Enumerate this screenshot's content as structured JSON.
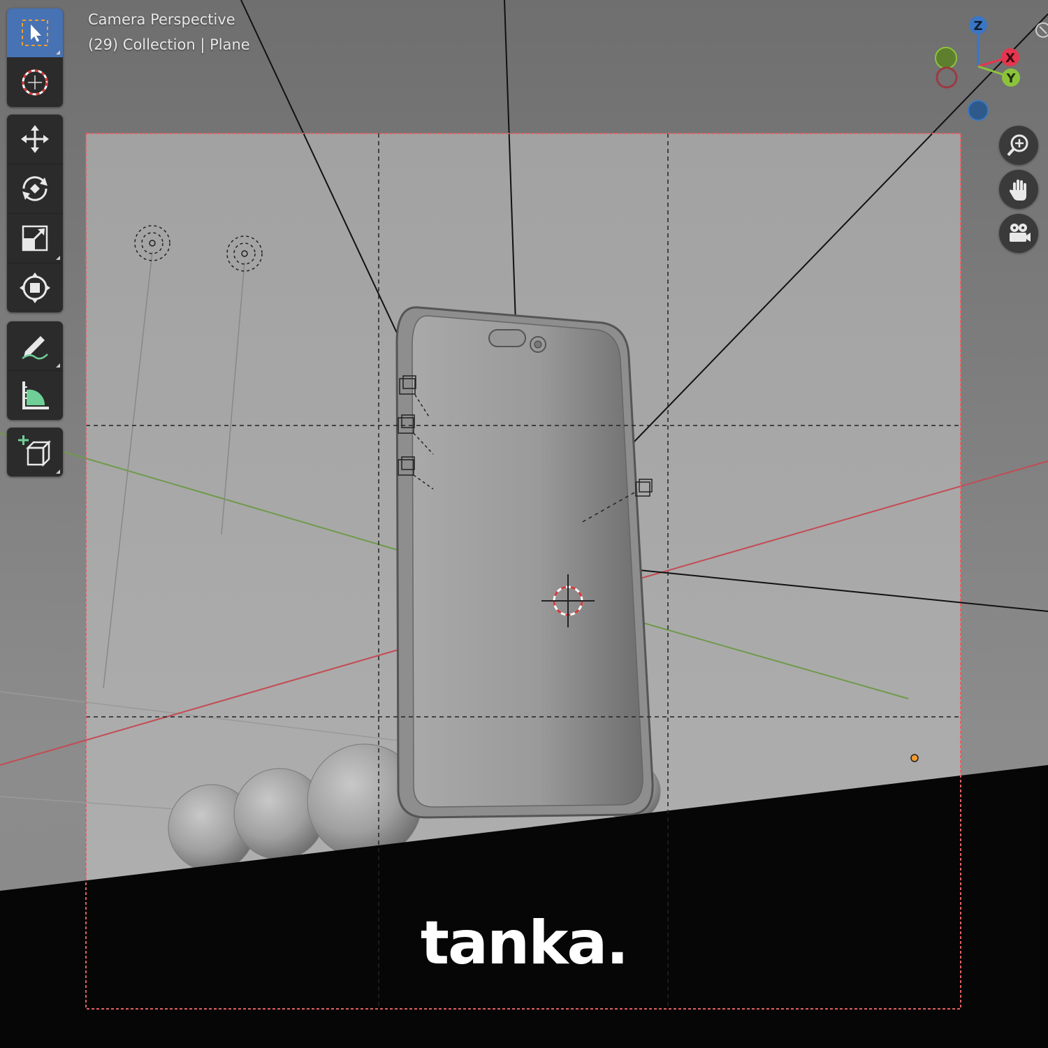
{
  "viewport": {
    "view_title": "Camera Perspective",
    "collection_label": "(29) Collection | Plane"
  },
  "toolbar": {
    "groups": [
      [
        "select-box-tool",
        "cursor-tool"
      ],
      [
        "move-tool",
        "rotate-tool",
        "scale-tool",
        "transform-tool"
      ],
      [
        "annotate-tool",
        "measure-tool"
      ],
      [
        "add-cube-tool"
      ]
    ],
    "active_tool": "select-box-tool"
  },
  "navigation": {
    "buttons": [
      "zoom-icon",
      "hand-pan-icon",
      "camera-view-icon"
    ]
  },
  "gizmo": {
    "axes": [
      "Z",
      "X",
      "Y"
    ],
    "colors": {
      "x": "#e5364f",
      "y": "#8bc43b",
      "z": "#3b76c4",
      "neg_x": "#9a3a44",
      "neg_y": "#5e7f2d",
      "neg_z": "#2d5a8a"
    }
  },
  "scene": {
    "objects": [
      "phone-model",
      "sphere",
      "sphere",
      "sphere",
      "sphere",
      "light",
      "light",
      "camera"
    ],
    "colors": {
      "axis_x": "#c44b54",
      "axis_y": "#6f9a4b",
      "camera_frame": "#e06060",
      "origin": "#f29a2e"
    }
  },
  "brand": {
    "text": "tanka."
  }
}
